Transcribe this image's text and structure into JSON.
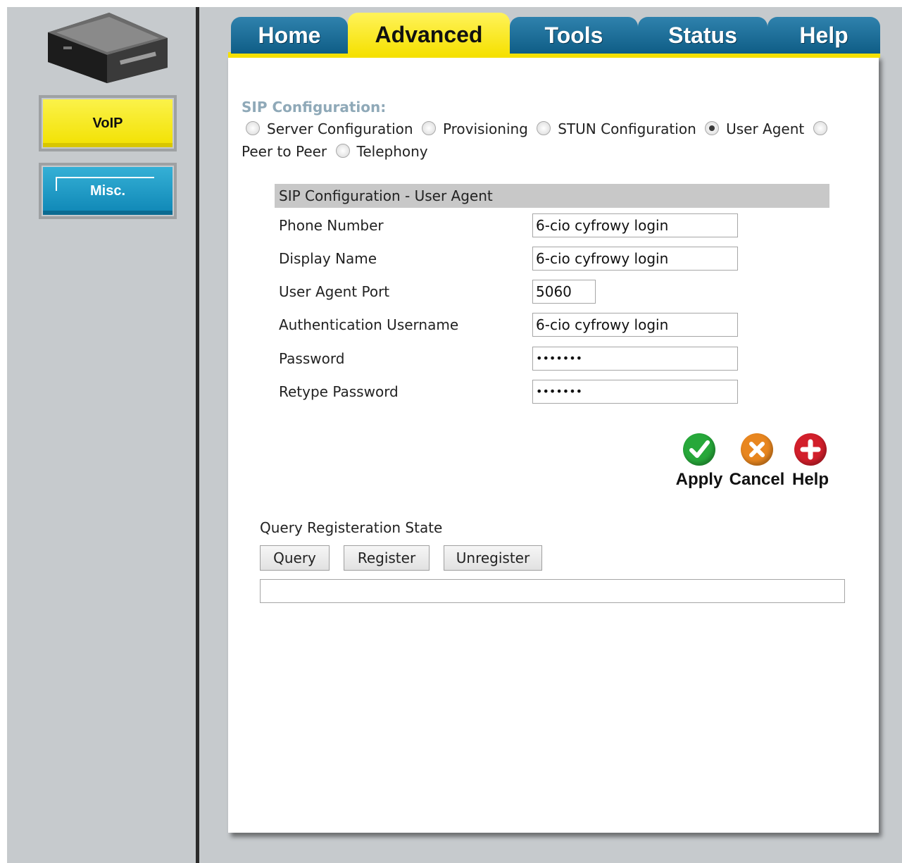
{
  "tabs": [
    "Home",
    "Advanced",
    "Tools",
    "Status",
    "Help"
  ],
  "sidebar": {
    "voip_label": "VoIP",
    "misc_label": "Misc."
  },
  "sip": {
    "title": "SIP Configuration:",
    "radio_options": [
      "Server Configuration",
      "Provisioning",
      "STUN Configuration",
      "User Agent",
      "Peer to Peer",
      "Telephony"
    ],
    "selected": "User Agent"
  },
  "user_agent": {
    "header": "SIP Configuration - User Agent",
    "fields": [
      {
        "label": "Phone Number",
        "value": "6-cio cyfrowy login"
      },
      {
        "label": "Display Name",
        "value": "6-cio cyfrowy login"
      },
      {
        "label": "User Agent Port",
        "value": "5060"
      },
      {
        "label": "Authentication Username",
        "value": "6-cio cyfrowy login"
      },
      {
        "label": "Password",
        "value": "•••••••"
      },
      {
        "label": "Retype Password",
        "value": "•••••••"
      }
    ]
  },
  "actions": {
    "apply": "Apply",
    "cancel": "Cancel",
    "help": "Help"
  },
  "colors": {
    "apply": "#27a83a",
    "cancel": "#e8861f",
    "help": "#d21f2b"
  },
  "query": {
    "label": "Query Registeration State",
    "buttons": [
      "Query",
      "Register",
      "Unregister"
    ],
    "result": ""
  }
}
